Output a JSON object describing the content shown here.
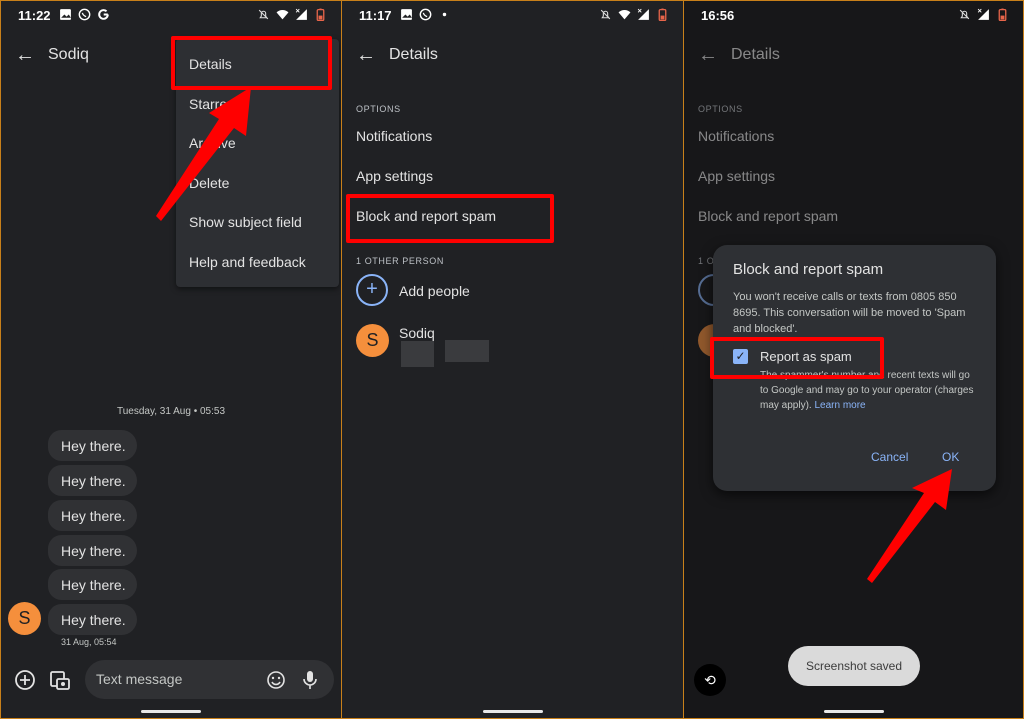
{
  "panels": [
    {
      "status": {
        "time": "11:22",
        "left_icons": [
          "image-icon",
          "whatsapp-icon",
          "google-icon"
        ],
        "right_icons": [
          "notifications-off-icon",
          "wifi-icon",
          "signal-icon",
          "battery-low-icon"
        ]
      },
      "appbar": {
        "back": "←",
        "title": "Sodiq"
      },
      "menu": {
        "items": [
          "Details",
          "Starred",
          "Archive",
          "Delete",
          "Show subject field",
          "Help and feedback"
        ],
        "highlighted": "Details"
      },
      "conversation": {
        "date_header": "Tuesday, 31 Aug • 05:53",
        "messages": [
          "Hey there.",
          "Hey there.",
          "Hey there.",
          "Hey there.",
          "Hey there.",
          "Hey there."
        ],
        "sender_initial": "S",
        "last_timestamp": "31 Aug, 05:54"
      },
      "compose": {
        "placeholder": "Text message",
        "icons": [
          "add-icon",
          "gallery-icon",
          "emoji-icon",
          "mic-icon"
        ]
      }
    },
    {
      "status": {
        "time": "11:17",
        "left_icons": [
          "image-icon",
          "whatsapp-icon",
          "dot-icon"
        ],
        "right_icons": [
          "notifications-off-icon",
          "wifi-icon",
          "signal-icon",
          "battery-low-icon"
        ]
      },
      "appbar": {
        "back": "←",
        "title": "Details"
      },
      "options_label": "OPTIONS",
      "options": [
        "Notifications",
        "App settings",
        "Block and report spam"
      ],
      "highlighted": "Block and report spam",
      "people_label": "1 OTHER PERSON",
      "add_people": "Add people",
      "contact": {
        "initial": "S",
        "name": "Sodiq"
      }
    },
    {
      "status": {
        "time": "16:56",
        "right_icons": [
          "notifications-off-icon",
          "signal-icon",
          "battery-low-icon"
        ]
      },
      "appbar": {
        "back": "←",
        "title": "Details"
      },
      "options_label": "OPTIONS",
      "options": [
        "Notifications",
        "App settings",
        "Block and report spam"
      ],
      "people_label_partial": "1 OT",
      "dialog": {
        "title": "Block and report spam",
        "body": "You won't receive calls or texts from 0805 850 8695. This conversation will be moved to 'Spam and blocked'.",
        "checkbox_label": "Report as spam",
        "checkbox_checked": true,
        "checkbox_desc": "The spammer's number and recent texts will go to Google and may go to your operator (charges may apply).",
        "learn_more": "Learn more",
        "cancel": "Cancel",
        "ok": "OK"
      },
      "toast": "Screenshot saved",
      "rotate_icon": "⟲"
    }
  ],
  "annotation_color": "#ff0000"
}
